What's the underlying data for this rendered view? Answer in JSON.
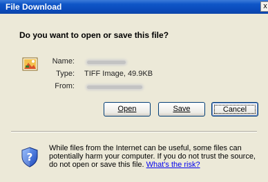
{
  "dialog": {
    "title": "File Download",
    "close_label": "x",
    "question": "Do you want to open or save this file?"
  },
  "file": {
    "name_label": "Name:",
    "type_label": "Type:",
    "type_value": "TIFF Image, 49.9KB",
    "from_label": "From:"
  },
  "buttons": {
    "open": "Open",
    "save": "Save",
    "cancel": "Cancel"
  },
  "warning": {
    "text": "While files from the Internet can be useful, some files can potentially harm your computer. If you do not trust the source, do not open or save this file.",
    "link": "What's the risk?"
  },
  "icons": {
    "file": "tiff-image-file-icon",
    "security": "security-shield-icon"
  },
  "colors": {
    "titlebar": "#0a4bbc",
    "dialog_bg": "#ece9d8",
    "link": "#0000ee"
  }
}
